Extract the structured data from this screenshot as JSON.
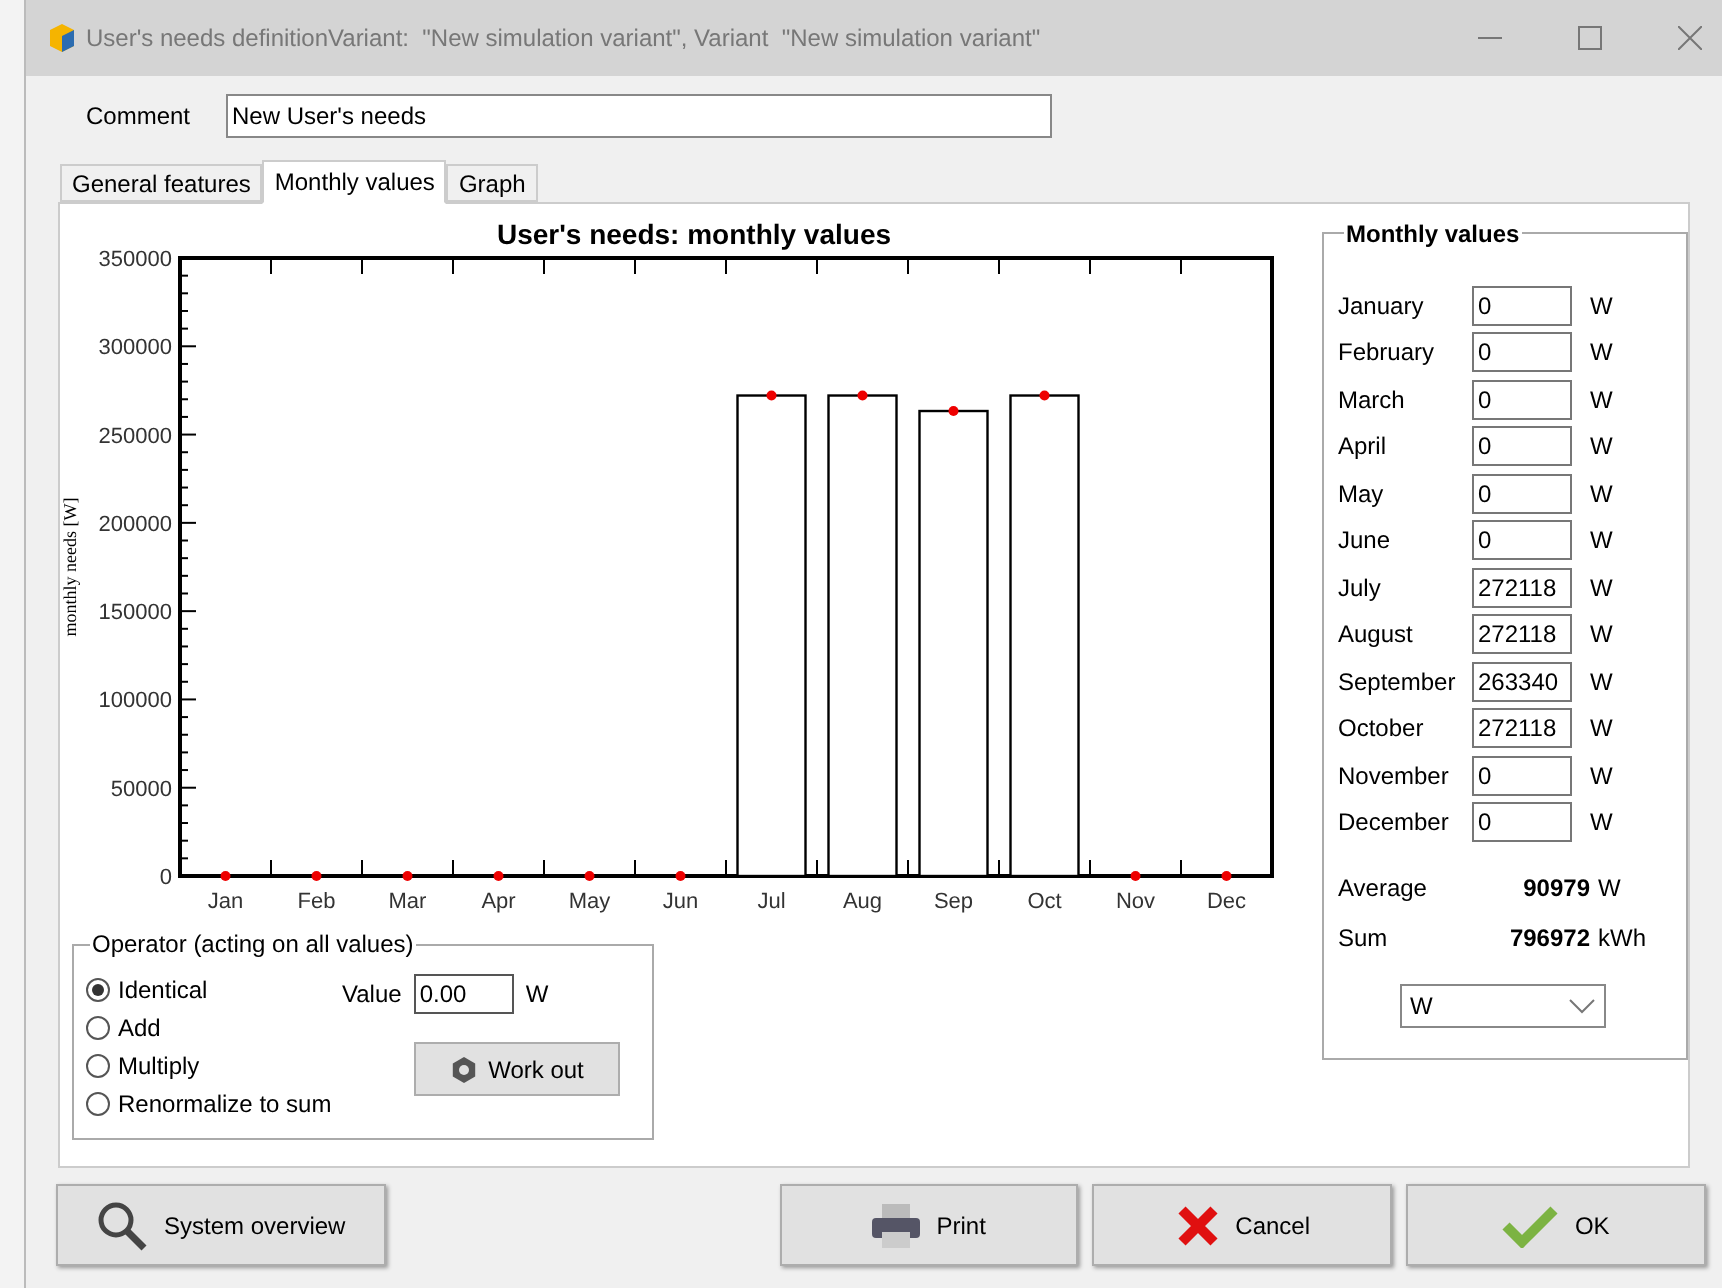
{
  "window": {
    "title": "User's needs definitionVariant:  \"New simulation variant\", Variant  \"New simulation variant\""
  },
  "comment": {
    "label": "Comment",
    "value": "New User's needs"
  },
  "tabs": [
    {
      "label": "General features",
      "selected": false
    },
    {
      "label": "Monthly values",
      "selected": true
    },
    {
      "label": "Graph",
      "selected": false
    }
  ],
  "chart": {
    "chart_data": {
      "type": "bar",
      "title": "User's needs: monthly values",
      "ylabel": "monthly needs [W]",
      "categories": [
        "Jan",
        "Feb",
        "Mar",
        "Apr",
        "May",
        "Jun",
        "Jul",
        "Aug",
        "Sep",
        "Oct",
        "Nov",
        "Dec"
      ],
      "series": [
        {
          "color": "#ffffff",
          "values": [
            0,
            0,
            0,
            0,
            0,
            0,
            272118,
            272118,
            263340,
            272118,
            0,
            0
          ]
        }
      ],
      "ylim": [
        0,
        350000
      ],
      "yticks": [
        0,
        50000,
        100000,
        150000,
        200000,
        250000,
        300000,
        350000
      ]
    }
  },
  "operator": {
    "title": "Operator (acting on all values)",
    "options": [
      {
        "label": "Identical",
        "selected": true
      },
      {
        "label": "Add",
        "selected": false
      },
      {
        "label": "Multiply",
        "selected": false
      },
      {
        "label": "Renormalize to sum",
        "selected": false
      }
    ],
    "value_label": "Value",
    "value": "0.00",
    "value_unit": "W",
    "work_out": "Work out"
  },
  "monthly_values": {
    "title": "Monthly values",
    "months": [
      {
        "label": "January",
        "value": "0",
        "unit": "W"
      },
      {
        "label": "February",
        "value": "0",
        "unit": "W"
      },
      {
        "label": "March",
        "value": "0",
        "unit": "W"
      },
      {
        "label": "April",
        "value": "0",
        "unit": "W"
      },
      {
        "label": "May",
        "value": "0",
        "unit": "W"
      },
      {
        "label": "June",
        "value": "0",
        "unit": "W"
      },
      {
        "label": "July",
        "value": "272118",
        "unit": "W"
      },
      {
        "label": "August",
        "value": "272118",
        "unit": "W"
      },
      {
        "label": "September",
        "value": "263340",
        "unit": "W"
      },
      {
        "label": "October",
        "value": "272118",
        "unit": "W"
      },
      {
        "label": "November",
        "value": "0",
        "unit": "W"
      },
      {
        "label": "December",
        "value": "0",
        "unit": "W"
      }
    ],
    "totals": [
      {
        "label": "Average",
        "value": "90979",
        "unit": "W"
      },
      {
        "label": "Sum",
        "value": "796972",
        "unit": "kWh"
      }
    ],
    "unit_select": "W"
  },
  "buttons": [
    {
      "kind": "overview",
      "label": "System overview"
    },
    {
      "kind": "print",
      "label": "Print"
    },
    {
      "kind": "cancel",
      "label": "Cancel"
    },
    {
      "kind": "ok",
      "label": "OK"
    }
  ]
}
